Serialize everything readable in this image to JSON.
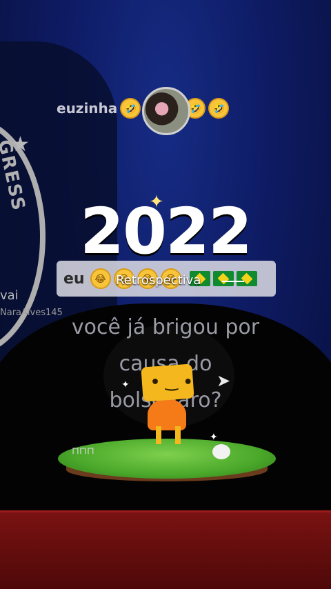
{
  "overlay": {
    "comment_user": "euzinha",
    "comment_emojis": [
      "🤣",
      "🤣",
      "🤣"
    ],
    "year": "2022",
    "pill_user": "eu",
    "pill_emojis": [
      "😂",
      "😂",
      "😂",
      "😂"
    ],
    "retrospective_label": "Retrospectiva",
    "question": "você já brigou por causa do bolsonaro?"
  },
  "sidebar": {
    "user": "vai",
    "handle": "NaraAlves145"
  },
  "background": {
    "seal_text": "GRESS",
    "accent_colors": {
      "flag_green": "#0f8a2f",
      "flag_yellow": "#f3d21b",
      "mascot_orange": "#f57a18"
    }
  }
}
